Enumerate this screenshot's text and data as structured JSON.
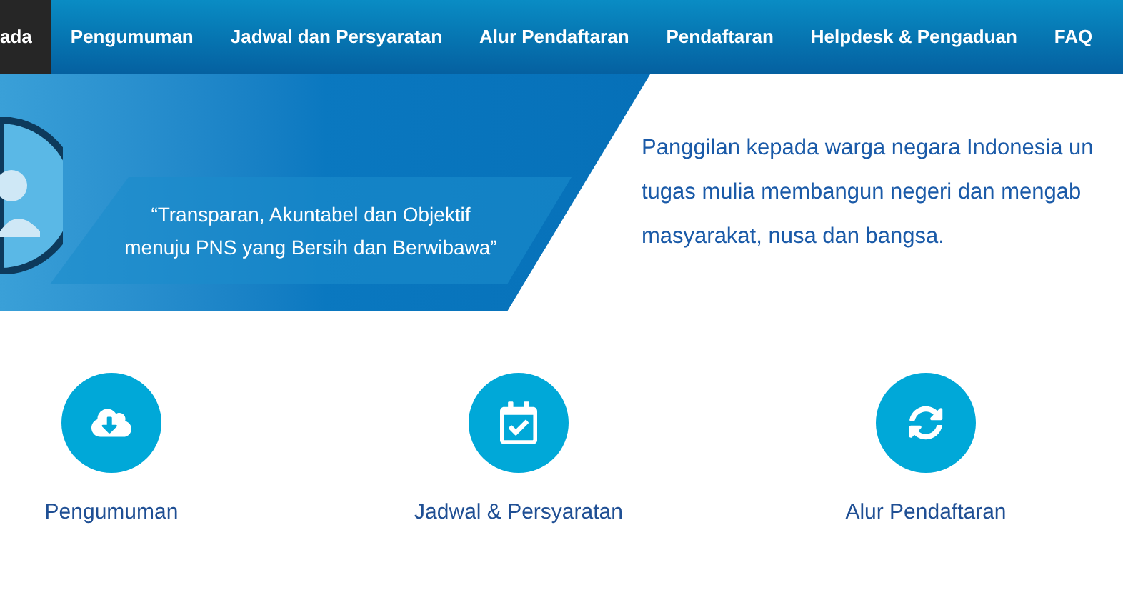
{
  "nav": {
    "items": [
      {
        "label": "ada",
        "selected": true
      },
      {
        "label": "Pengumuman",
        "selected": false
      },
      {
        "label": "Jadwal dan Persyaratan",
        "selected": false
      },
      {
        "label": "Alur Pendaftaran",
        "selected": false
      },
      {
        "label": "Pendaftaran",
        "selected": false
      },
      {
        "label": "Helpdesk & Pengaduan",
        "selected": false
      },
      {
        "label": "FAQ",
        "selected": false
      }
    ]
  },
  "banner": {
    "quote_lines": [
      "“Transparan, Akuntabel dan Objektif",
      "menuju PNS yang Bersih dan Berwibawa”"
    ]
  },
  "intro": {
    "lines": [
      "Panggilan kepada warga negara Indonesia un",
      "tugas mulia membangun negeri dan mengab",
      "masyarakat, nusa dan bangsa."
    ]
  },
  "features": [
    {
      "kind": "download",
      "label": "Pengumuman"
    },
    {
      "kind": "calendar",
      "label": "Jadwal & Persyaratan"
    },
    {
      "kind": "refresh",
      "label": "Alur Pendaftaran"
    }
  ]
}
